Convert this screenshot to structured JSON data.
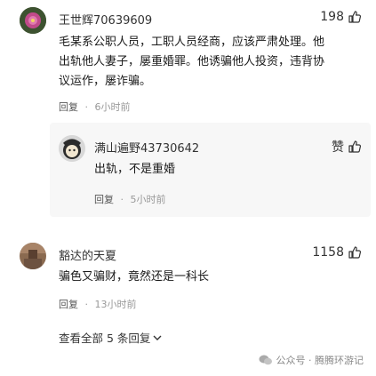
{
  "comments": [
    {
      "username": "王世辉70639609",
      "likes": "198",
      "text_lines": [
        "毛某系公职人员，工职人员经商，应该严肃处理。他",
        "出轨他人妻子，屡重婚罪。他诱骗他人投资，违背协",
        "议运作，屡诈骗。"
      ],
      "reply_label": "回复",
      "separator": "·",
      "time": "6小时前",
      "avatar_icon": "flower-avatar"
    },
    {
      "username": "满山遍野43730642",
      "likes": "赞",
      "text_lines": [
        "出轨，不是重婚"
      ],
      "reply_label": "回复",
      "separator": "·",
      "time": "5小时前",
      "avatar_icon": "cartoon-avatar"
    },
    {
      "username": "豁达的天夏",
      "likes": "1158",
      "text_lines": [
        "骗色又骗财，竟然还是一科长"
      ],
      "reply_label": "回复",
      "separator": "·",
      "time": "13小时前",
      "avatar_icon": "photo-avatar"
    }
  ],
  "view_all": "查看全部 5 条回复",
  "watermark": "公众号 · 腾腾环游记",
  "colors": {
    "reply_bg": "#f7f7f7",
    "time": "#999999"
  }
}
